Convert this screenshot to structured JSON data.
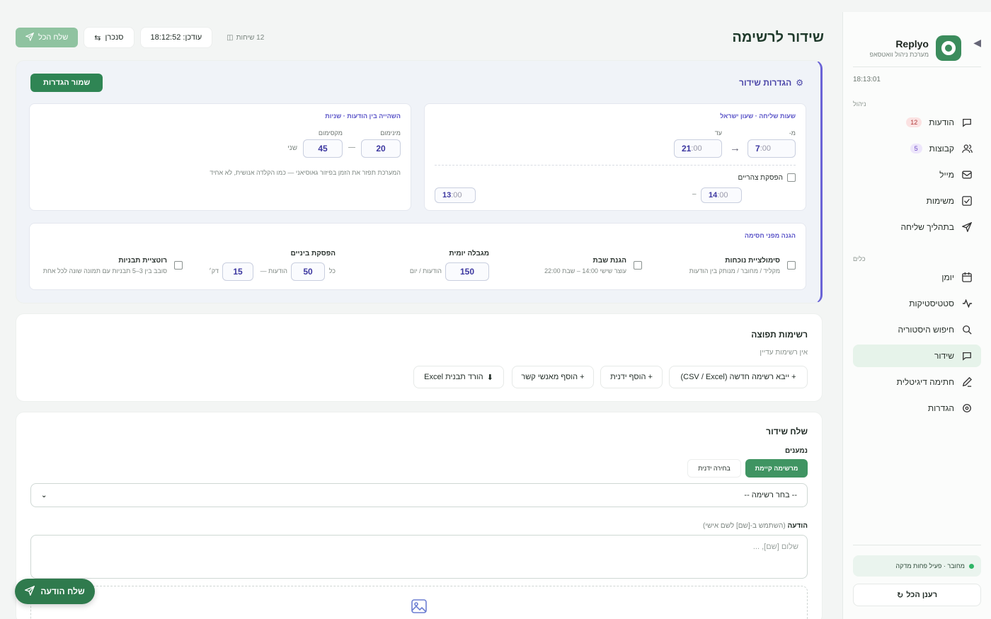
{
  "brand": {
    "name": "Replyo",
    "subtitle": "מערכת ניהול וואטסאפ"
  },
  "sidebar": {
    "time": "18:13:01",
    "sections": [
      {
        "title": "ניהול",
        "items": [
          {
            "label": "הודעות",
            "icon": "chat-icon",
            "badge": "12"
          },
          {
            "label": "קבוצות",
            "icon": "users-icon",
            "badge": "5"
          },
          {
            "label": "מייל",
            "icon": "mail-icon"
          },
          {
            "label": "משימות",
            "icon": "checkbox-icon"
          },
          {
            "label": "בתהליך שליחה",
            "icon": "send-icon"
          }
        ]
      },
      {
        "title": "כלים",
        "items": [
          {
            "label": "יומן",
            "icon": "calendar-icon"
          },
          {
            "label": "סטטיסטיקות",
            "icon": "activity-icon"
          },
          {
            "label": "חיפוש היסטוריה",
            "icon": "search-icon"
          },
          {
            "label": "שידור",
            "icon": "broadcast-chat-icon",
            "active": true
          },
          {
            "label": "חתימה דיגיטלית",
            "icon": "pen-icon"
          },
          {
            "label": "הגדרות",
            "icon": "settings-icon"
          }
        ]
      }
    ],
    "status": "מחובר · פעיל פחות מדקה",
    "refresh": "רענן הכל"
  },
  "header": {
    "title": "שידור לרשימה",
    "send_all": "שלח הכל",
    "sync": "סנכרן",
    "updated": "עודכן: 18:12:52",
    "sessions": "12 שיחות"
  },
  "settings": {
    "title": "הגדרות שידור",
    "save": "שמור הגדרות",
    "hours": {
      "label": "שעות שליחה · שעון ישראל",
      "from_label": "מ-",
      "to_label": "עד",
      "from": "7",
      "to": "21",
      "suffix": ":00",
      "lunch_label": "הפסקת צהריים",
      "lunch_from": "14",
      "lunch_to": "13"
    },
    "delay": {
      "label": "השהייה בין הודעות · שניות",
      "min_label": "מינימום",
      "max_label": "מקסימום",
      "min": "20",
      "max": "45",
      "unit": "שני",
      "note": "המערכת תפזר את הזמן בפיזור גאוסיאני — כמו הקלדה אנושית, לא אחיד"
    },
    "protection": {
      "label": "הגנה מפני חסימה",
      "presence": {
        "title": "סימולציית נוכחות",
        "desc": "מקליד / מחובר / מנותק בין הודעות"
      },
      "shabbat": {
        "title": "הגנת שבת",
        "desc": "עוצר שישי 14:00 – שבת 22:00"
      },
      "daily": {
        "title": "מגבלה יומית",
        "value": "150",
        "unit": "הודעות / יום"
      },
      "pause": {
        "title": "הפסקת ביניים",
        "every": "כל",
        "count": "50",
        "msgs": "הודעות —",
        "minutes": "15",
        "unit": "דק׳"
      },
      "rotation": {
        "title": "רוטציית תבניות",
        "desc": "סובב בין 3–5 תבניות עם תמונה שונה לכל אחת"
      }
    }
  },
  "lists": {
    "title": "רשימות תפוצה",
    "empty": "אין רשימות עדיין",
    "import": "+ ייבא רשימה חדשה (CSV / Excel)",
    "add_manual": "+ הוסף ידנית",
    "add_contacts": "+ הוסף מאנשי קשר",
    "download": "הורד תבנית Excel"
  },
  "send": {
    "title": "שלח שידור",
    "recipients": "נמענים",
    "tab_existing": "מרשימה קיימת",
    "tab_manual": "בחירה ידנית",
    "select_placeholder": "-- בחר רשימה --",
    "message_label": "הודעה",
    "message_hint": "(השתמש ב-[שם] לשם אישי)",
    "message_placeholder": "שלום [שם], ...",
    "fab": "שלח הודעה"
  },
  "colors": {
    "brand": "#3b8c5c",
    "accent": "#5a54c8",
    "active_bg": "#e6f3ea"
  }
}
